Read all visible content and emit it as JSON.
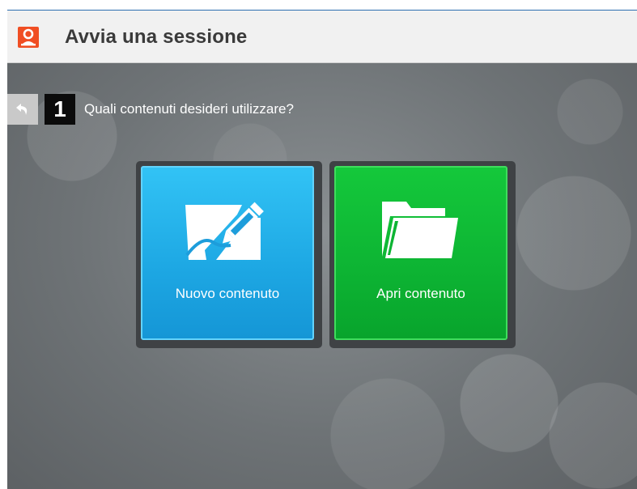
{
  "window": {
    "title": "Avvia una sessione"
  },
  "wizard": {
    "step_number": "1",
    "question": "Quali contenuti desideri utilizzare?"
  },
  "options": [
    {
      "label": "Nuovo contenuto",
      "icon": "pen-on-paper-icon",
      "color": "#1da7e3"
    },
    {
      "label": "Apri contenuto",
      "icon": "open-folder-icon",
      "color": "#0db433"
    }
  ],
  "colors": {
    "accent": "#f04e23",
    "background": "#7a7f82"
  }
}
